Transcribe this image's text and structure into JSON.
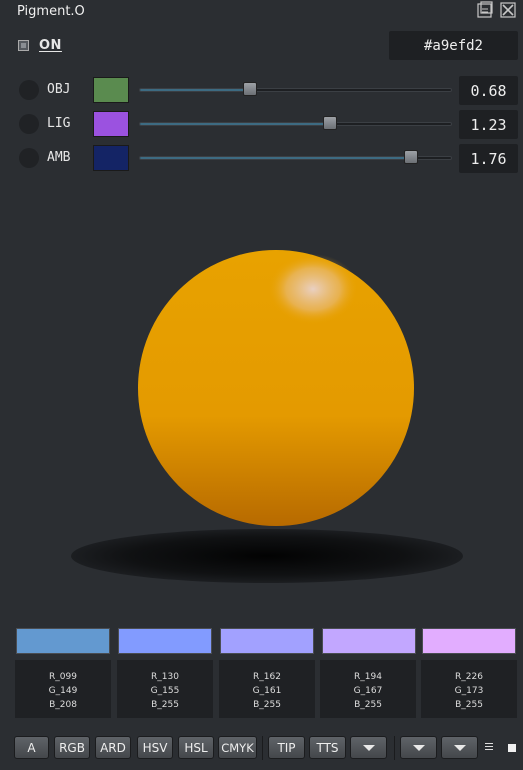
{
  "window": {
    "title": "Pigment.O"
  },
  "toggle": {
    "label": "ON",
    "checked": false
  },
  "hex": {
    "value": "#a9efd2"
  },
  "sliders": [
    {
      "label": "OBJ",
      "swatch_color": "#5a8b4f",
      "value_text": "0.68",
      "fraction": 0.355
    },
    {
      "label": "LIG",
      "swatch_color": "#9b52e0",
      "value_text": "1.23",
      "fraction": 0.61
    },
    {
      "label": "AMB",
      "swatch_color": "#142465",
      "value_text": "1.76",
      "fraction": 0.87
    }
  ],
  "sphere": {
    "base_color": "#e8a200",
    "shadow_color": "#b76a00",
    "highlight_color": "#e9d0c2"
  },
  "palette": [
    {
      "color": "#6399d0",
      "r": "R_099",
      "g": "G_149",
      "b": "B_208"
    },
    {
      "color": "#829bff",
      "r": "R_130",
      "g": "G_155",
      "b": "B_255"
    },
    {
      "color": "#a2a1ff",
      "r": "R_162",
      "g": "G_161",
      "b": "B_255"
    },
    {
      "color": "#c2a7ff",
      "r": "R_194",
      "g": "G_167",
      "b": "B_255"
    },
    {
      "color": "#e2adff",
      "r": "R_226",
      "g": "G_173",
      "b": "B_255"
    }
  ],
  "bottom_buttons": {
    "a": "A",
    "rgb": "RGB",
    "ard": "ARD",
    "hsv": "HSV",
    "hsl": "HSL",
    "cmyk": "CMYK",
    "tip": "TIP",
    "tts": "TTS"
  },
  "icons": {
    "title_left": "float-window-icon",
    "title_right": "close-window-icon",
    "dropdowns": "chevron-down-icon",
    "menu": "menu-lines-icon",
    "square": "square-icon"
  }
}
